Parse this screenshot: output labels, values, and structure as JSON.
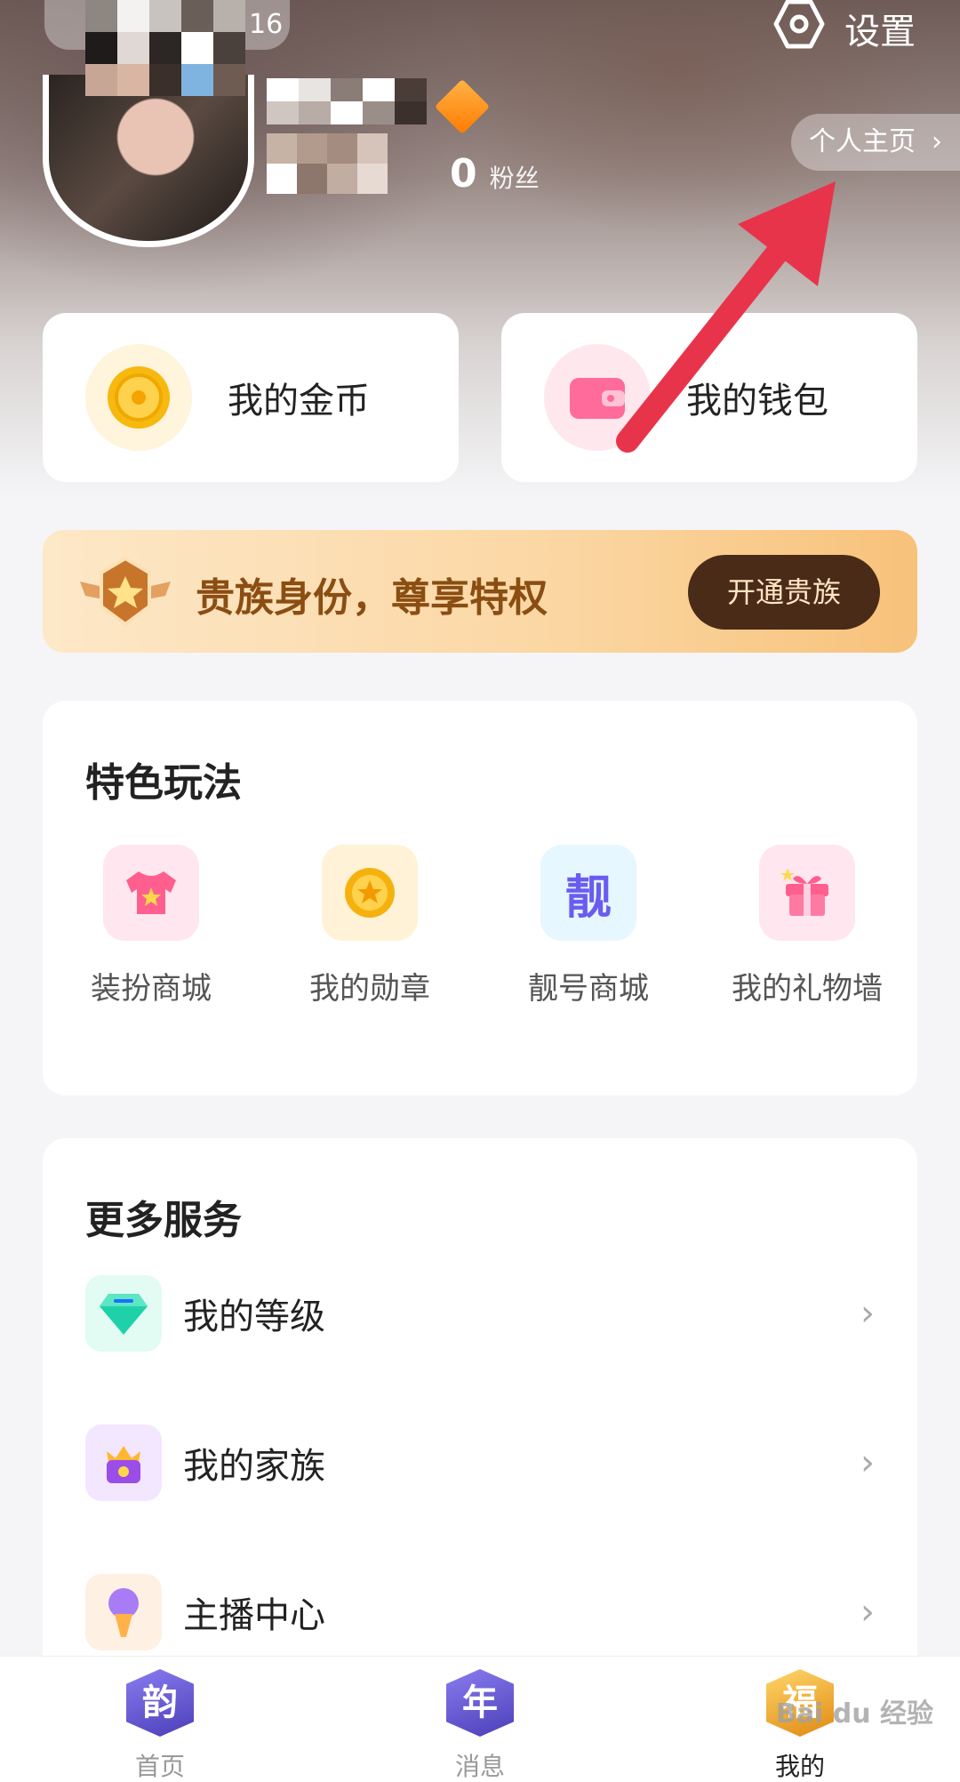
{
  "header": {
    "status_text": "16",
    "settings_label": "设置",
    "fans_count": "0",
    "fans_label": "粉丝",
    "profile_link": "个人主页",
    "profile_chevron": "›"
  },
  "cards": {
    "coins_label": "我的金币",
    "wallet_label": "我的钱包"
  },
  "noble": {
    "text": "贵族身份，尊享特权",
    "button": "开通贵族"
  },
  "features": {
    "title": "特色玩法",
    "items": [
      {
        "label": "装扮商城",
        "icon": "shirt-icon"
      },
      {
        "label": "我的勋章",
        "icon": "medal-icon"
      },
      {
        "label": "靓号商城",
        "icon": "liang-icon",
        "glyph": "靓"
      },
      {
        "label": "我的礼物墙",
        "icon": "gift-icon"
      }
    ]
  },
  "services": {
    "title": "更多服务",
    "chevron": "›",
    "items": [
      {
        "label": "我的等级",
        "icon": "diamond-icon"
      },
      {
        "label": "我的家族",
        "icon": "family-icon"
      },
      {
        "label": "主播中心",
        "icon": "microphone-icon"
      }
    ]
  },
  "bottom_nav": {
    "items": [
      {
        "label": "首页",
        "glyph": "韵"
      },
      {
        "label": "消息",
        "glyph": "年"
      },
      {
        "label": "我的",
        "glyph": "福",
        "active": true
      }
    ]
  },
  "watermark": "Bai du 经验",
  "colors": {
    "accent_gold": "#f5a623",
    "noble_text": "#8a4d12",
    "noble_button": "#4a2b18",
    "annotation_arrow": "#e8344a"
  }
}
